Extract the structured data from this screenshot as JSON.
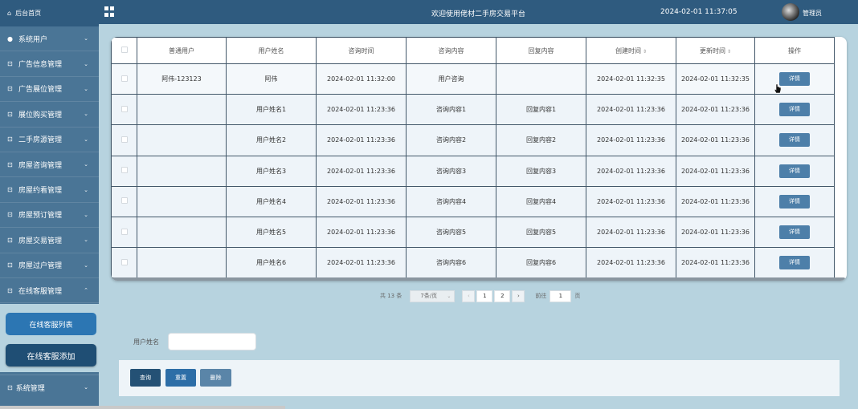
{
  "header": {
    "title": "欢迎使用佬材二手房交易平台",
    "datetime": "2024-02-01 11:37:05",
    "user": "管理员"
  },
  "sidebar": {
    "home": "后台首页",
    "items": [
      {
        "label": "系统用户",
        "icon": "person-icon",
        "expanded": false
      },
      {
        "label": "广告信息管理",
        "icon": "doc-icon",
        "expanded": false
      },
      {
        "label": "广告展位管理",
        "icon": "doc-icon",
        "expanded": false
      },
      {
        "label": "展位购买管理",
        "icon": "doc-icon",
        "expanded": false
      },
      {
        "label": "二手房源管理",
        "icon": "doc-icon",
        "expanded": false
      },
      {
        "label": "房屋咨询管理",
        "icon": "doc-icon",
        "expanded": false
      },
      {
        "label": "房屋约看管理",
        "icon": "doc-icon",
        "expanded": false
      },
      {
        "label": "房屋预订管理",
        "icon": "doc-icon",
        "expanded": false
      },
      {
        "label": "房屋交易管理",
        "icon": "doc-icon",
        "expanded": false
      },
      {
        "label": "房屋过户管理",
        "icon": "doc-icon",
        "expanded": false
      },
      {
        "label": "在线客服管理",
        "icon": "doc-icon",
        "expanded": true
      }
    ],
    "sub_items": [
      "在线客服列表",
      "在线客服添加"
    ],
    "bottom": {
      "label": "系统管理",
      "icon": "doc-icon"
    }
  },
  "table": {
    "columns": [
      "普通用户",
      "用户姓名",
      "咨询时间",
      "咨询内容",
      "回复内容",
      "创建时间",
      "更新时间",
      "操作"
    ],
    "sortable_marker": "⇕",
    "rows": [
      {
        "user": "阿伟-123123",
        "name": "阿伟",
        "time": "2024-02-01 11:32:00",
        "content": "用户咨询",
        "reply": "",
        "created": "2024-02-01 11:32:35",
        "updated": "2024-02-01 11:32:35",
        "action": "详情"
      },
      {
        "user": "",
        "name": "用户姓名1",
        "time": "2024-02-01 11:23:36",
        "content": "咨询内容1",
        "reply": "回复内容1",
        "created": "2024-02-01 11:23:36",
        "updated": "2024-02-01 11:23:36",
        "action": "详情"
      },
      {
        "user": "",
        "name": "用户姓名2",
        "time": "2024-02-01 11:23:36",
        "content": "咨询内容2",
        "reply": "回复内容2",
        "created": "2024-02-01 11:23:36",
        "updated": "2024-02-01 11:23:36",
        "action": "详情"
      },
      {
        "user": "",
        "name": "用户姓名3",
        "time": "2024-02-01 11:23:36",
        "content": "咨询内容3",
        "reply": "回复内容3",
        "created": "2024-02-01 11:23:36",
        "updated": "2024-02-01 11:23:36",
        "action": "详情"
      },
      {
        "user": "",
        "name": "用户姓名4",
        "time": "2024-02-01 11:23:36",
        "content": "咨询内容4",
        "reply": "回复内容4",
        "created": "2024-02-01 11:23:36",
        "updated": "2024-02-01 11:23:36",
        "action": "详情"
      },
      {
        "user": "",
        "name": "用户姓名5",
        "time": "2024-02-01 11:23:36",
        "content": "咨询内容5",
        "reply": "回复内容5",
        "created": "2024-02-01 11:23:36",
        "updated": "2024-02-01 11:23:36",
        "action": "详情"
      },
      {
        "user": "",
        "name": "用户姓名6",
        "time": "2024-02-01 11:23:36",
        "content": "咨询内容6",
        "reply": "回复内容6",
        "created": "2024-02-01 11:23:36",
        "updated": "2024-02-01 11:23:36",
        "action": "详情"
      }
    ]
  },
  "pagination": {
    "total": "共 13 条",
    "page_size": "7条/页",
    "prev": "‹",
    "next": "›",
    "pages": [
      "1",
      "2"
    ],
    "goto_label": "前往",
    "goto_value": "1",
    "goto_suffix": "页"
  },
  "search": {
    "label": "用户姓名",
    "value": ""
  },
  "actions": {
    "query": "查询",
    "reset": "重置",
    "delete": "删除"
  }
}
